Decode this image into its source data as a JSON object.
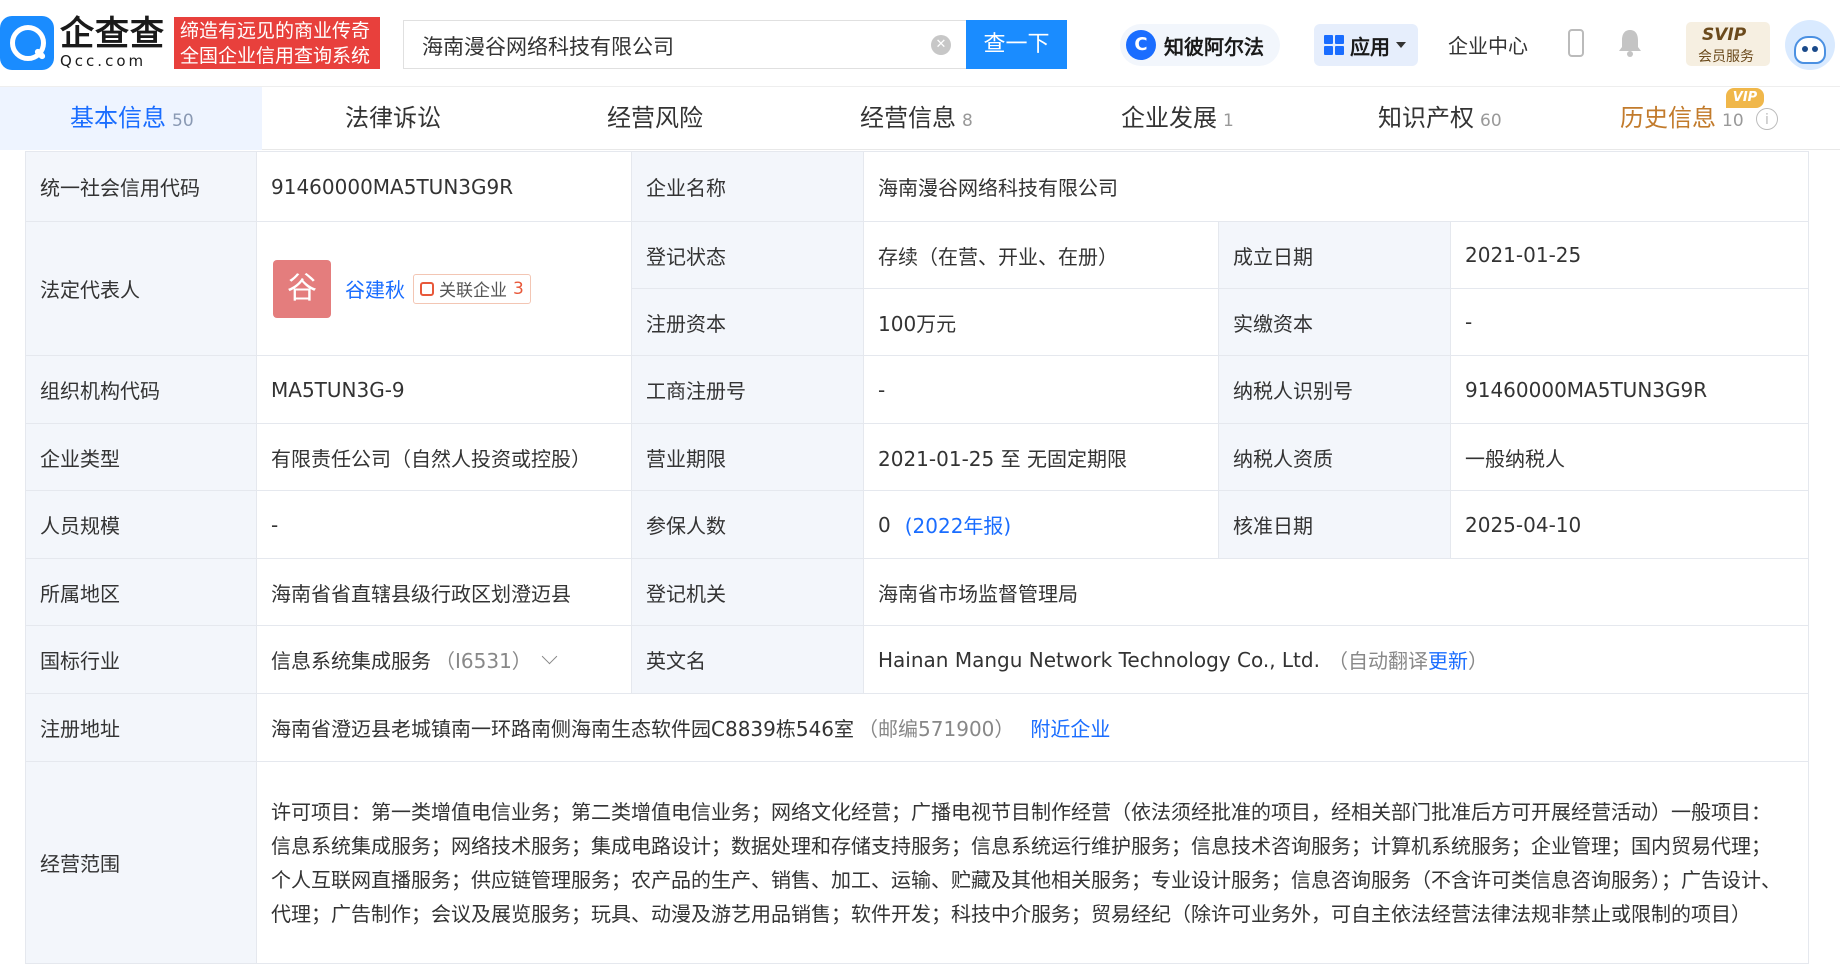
{
  "header": {
    "logo_cn": "企查查",
    "logo_en": "Qcc.com",
    "slogan_line1": "缔造有远见的商业传奇",
    "slogan_line2": "全国企业信用查询系统",
    "search_value": "海南漫谷网络科技有限公司",
    "search_button": "查一下",
    "zhibi_label": "知彼阿尔法",
    "apps_label": "应用",
    "enterprise_center": "企业中心",
    "svip_top": "SVIP",
    "svip_bottom": "会员服务"
  },
  "tabs": [
    {
      "label": "基本信息",
      "count": "50"
    },
    {
      "label": "法律诉讼",
      "count": ""
    },
    {
      "label": "经营风险",
      "count": ""
    },
    {
      "label": "经营信息",
      "count": "8"
    },
    {
      "label": "企业发展",
      "count": "1"
    },
    {
      "label": "知识产权",
      "count": "60"
    },
    {
      "label": "历史信息",
      "count": "10"
    }
  ],
  "vip_badge": "VIP",
  "info": {
    "credit_code_label": "统一社会信用代码",
    "credit_code": "91460000MA5TUN3G9R",
    "company_name_label": "企业名称",
    "company_name": "海南漫谷网络科技有限公司",
    "legal_rep_label": "法定代表人",
    "legal_rep_avatar": "谷",
    "legal_rep_name": "谷建秋",
    "related_label": "关联企业",
    "related_count": "3",
    "reg_status_label": "登记状态",
    "reg_status": "存续（在营、开业、在册）",
    "found_date_label": "成立日期",
    "found_date": "2021-01-25",
    "reg_capital_label": "注册资本",
    "reg_capital": "100万元",
    "paid_capital_label": "实缴资本",
    "paid_capital": "-",
    "org_code_label": "组织机构代码",
    "org_code": "MA5TUN3G-9",
    "biz_reg_no_label": "工商注册号",
    "biz_reg_no": "-",
    "taxpayer_id_label": "纳税人识别号",
    "taxpayer_id": "91460000MA5TUN3G9R",
    "ent_type_label": "企业类型",
    "ent_type": "有限责任公司（自然人投资或控股）",
    "biz_term_label": "营业期限",
    "biz_term": "2021-01-25 至 无固定期限",
    "taxpayer_qual_label": "纳税人资质",
    "taxpayer_qual": "一般纳税人",
    "staff_size_label": "人员规模",
    "staff_size": "-",
    "insured_label": "参保人数",
    "insured": "0",
    "insured_report": "(2022年报)",
    "approval_date_label": "核准日期",
    "approval_date": "2025-04-10",
    "region_label": "所属地区",
    "region": "海南省省直辖县级行政区划澄迈县",
    "reg_authority_label": "登记机关",
    "reg_authority": "海南省市场监督管理局",
    "industry_label": "国标行业",
    "industry": "信息系统集成服务",
    "industry_code": "（I6531）",
    "english_name_label": "英文名",
    "english_name": "Hainan Mangu Network Technology Co., Ltd.",
    "english_note_prefix": "（自动翻译",
    "english_note_link": "更新",
    "english_note_suffix": "）",
    "address_label": "注册地址",
    "address": "海南省澄迈县老城镇南一环路南侧海南生态软件园C8839栋546室",
    "postcode": "（邮编571900）",
    "nearby_link": "附近企业",
    "scope_label": "经营范围",
    "scope": "许可项目：第一类增值电信业务；第二类增值电信业务；网络文化经营；广播电视节目制作经营（依法须经批准的项目，经相关部门批准后方可开展经营活动）一般项目：信息系统集成服务；网络技术服务；集成电路设计；数据处理和存储支持服务；信息系统运行维护服务；信息技术咨询服务；计算机系统服务；企业管理；国内贸易代理；个人互联网直播服务；供应链管理服务；农产品的生产、销售、加工、运输、贮藏及其他相关服务；专业设计服务；信息咨询服务（不含许可类信息咨询服务）；广告设计、代理；广告制作；会议及展览服务；玩具、动漫及游艺用品销售；软件开发；科技中介服务；贸易经纪（除许可业务外，可自主依法经营法律法规非禁止或限制的项目）"
  },
  "colors": {
    "brand_blue": "#1a8cff",
    "link_blue": "#1a6dff",
    "slogan_red": "#e8403c",
    "label_bg": "#f3f6fb",
    "history_orange": "#c27b2c"
  }
}
